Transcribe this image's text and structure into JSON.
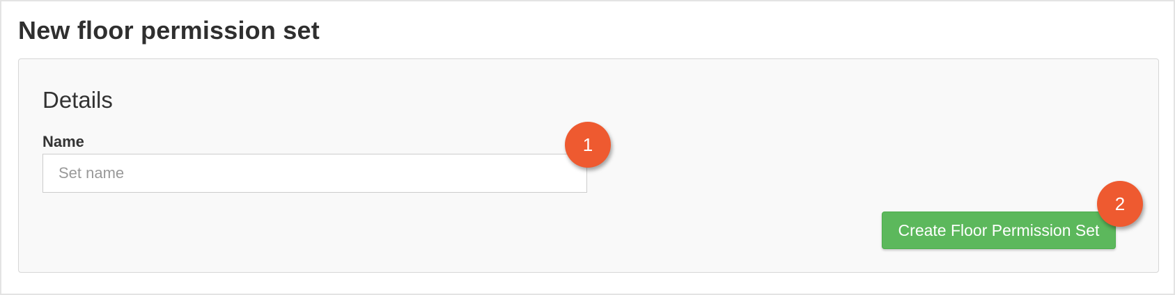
{
  "page": {
    "title": "New floor permission set"
  },
  "details": {
    "heading": "Details",
    "name_label": "Name",
    "name_value": "",
    "name_placeholder": "Set name"
  },
  "actions": {
    "create_label": "Create Floor Permission Set"
  },
  "callouts": {
    "one": "1",
    "two": "2"
  },
  "colors": {
    "button_green": "#5cb85c",
    "callout_orange": "#ee5a30",
    "panel_background": "#f9f9f9"
  }
}
